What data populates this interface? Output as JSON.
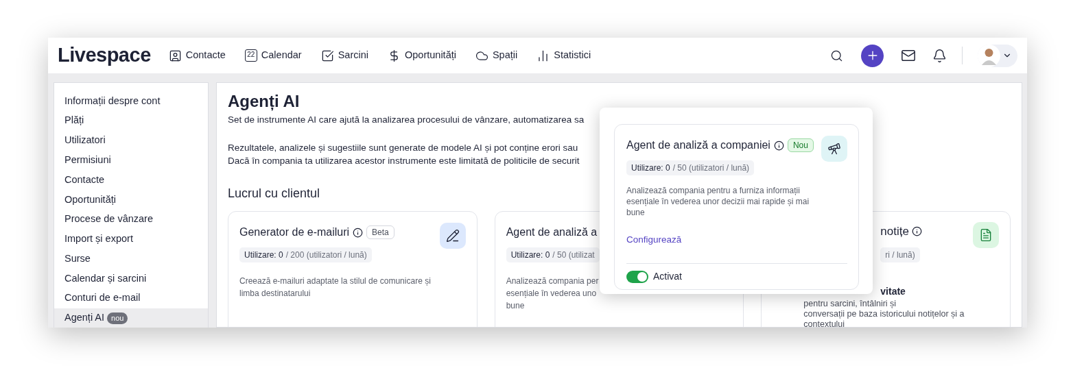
{
  "header": {
    "logo": "Livespace",
    "nav": [
      {
        "kind": "contact",
        "label": "Contacte"
      },
      {
        "kind": "calendar",
        "label": "Calendar",
        "icon_text": "22"
      },
      {
        "kind": "task",
        "label": "Sarcini"
      },
      {
        "kind": "money",
        "label": "Oportunități"
      },
      {
        "kind": "cloud",
        "label": "Spații"
      },
      {
        "kind": "stats",
        "label": "Statistici"
      }
    ]
  },
  "sidebar": {
    "items": [
      {
        "label": "Informații despre cont",
        "selected": false
      },
      {
        "label": "Plăți",
        "selected": false
      },
      {
        "label": "Utilizatori",
        "selected": false
      },
      {
        "label": "Permisiuni",
        "selected": false
      },
      {
        "label": "Contacte",
        "selected": false
      },
      {
        "label": "Oportunități",
        "selected": false
      },
      {
        "label": "Procese de vânzare",
        "selected": false
      },
      {
        "label": "Import și export",
        "selected": false
      },
      {
        "label": "Surse",
        "selected": false
      },
      {
        "label": "Calendar și sarcini",
        "selected": false
      },
      {
        "label": "Conturi de e-mail",
        "selected": false
      },
      {
        "label": "Agenți AI",
        "selected": true,
        "badge": "nou"
      }
    ]
  },
  "main": {
    "title": "Agenți AI",
    "intro": "Set de instrumente AI care ajută la analizarea procesului de vânzare, automatizarea sa",
    "notes": [
      "Rezultatele, analizele și sugestiile sunt generate de modele AI și pot conține erori sau",
      "Dacă în compania ta utilizarea acestor instrumente este limitată de politicile de securit"
    ],
    "section": "Lucrul cu clientul",
    "cards": [
      {
        "kind": "full",
        "title": "Generator de e-mailuri",
        "badge": "Beta",
        "usage_count": "Utilizare: 0",
        "usage_limit": "/ 200 (utilizatori / lună)",
        "description": "Creează e-mailuri adaptate la stilul de comunicare și limba destinatarului"
      },
      {
        "kind": "left",
        "title": "Agent de analiză a",
        "usage_count": "Utilizare: 0",
        "usage_limit": "/ 50 (utilizat",
        "description": "Analizează compania per\nesențiale în vederea uno\nbune"
      },
      {
        "kind": "right",
        "title": "notițe",
        "usage_limit": "ri / lună)",
        "subtitle": "vitate",
        "description": "pentru sarcini, întâlniri și\nconversații pe baza istoricului notițelor și a\ncontextului"
      }
    ]
  },
  "popup": {
    "title": "Agent de analiză a companiei",
    "badge": "Nou",
    "usage_count": "Utilizare: 0",
    "usage_limit": "/ 50 (utilizatori / lună)",
    "description": "Analizează compania pentru a furniza informații esențiale în vederea unor decizii mai rapide și mai bune",
    "link": "Configurează",
    "toggle": {
      "on": true,
      "label": "Activat"
    }
  }
}
